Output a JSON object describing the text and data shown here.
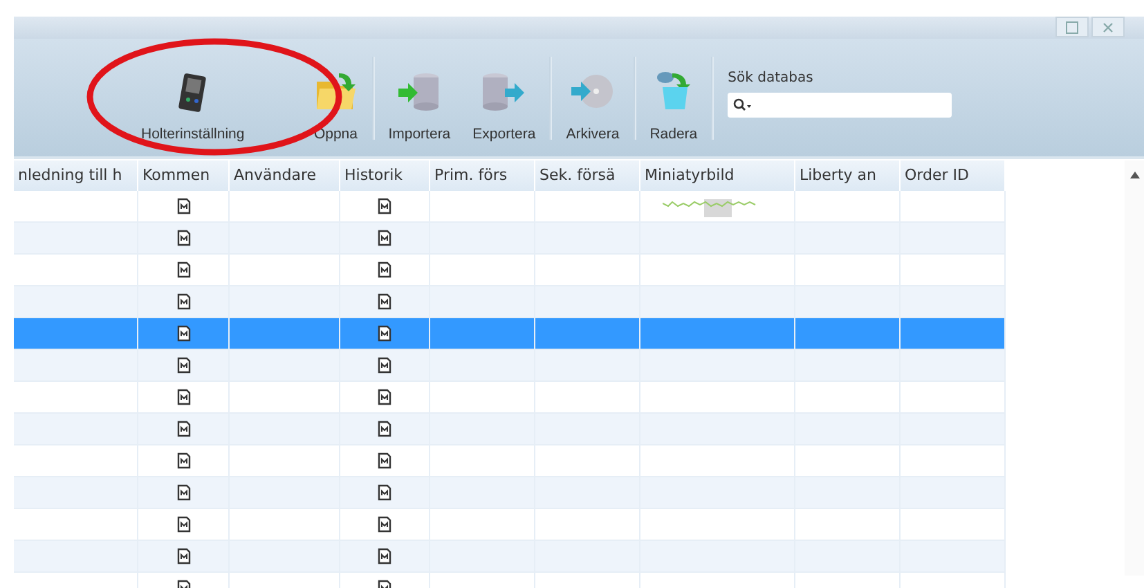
{
  "toolbar": {
    "buttons": [
      {
        "label": "Holterinställning",
        "kind": "device"
      },
      {
        "label": "Öppna",
        "kind": "folder"
      },
      {
        "label": "Importera",
        "kind": "import"
      },
      {
        "label": "Exportera",
        "kind": "export"
      },
      {
        "label": "Arkivera",
        "kind": "archive"
      },
      {
        "label": "Radera",
        "kind": "delete"
      }
    ],
    "search": {
      "label": "Sök databas"
    }
  },
  "table": {
    "columns": [
      "nledning till h",
      "Kommen",
      "Användare",
      "Historik",
      "Prim. förs",
      "Sek. försä",
      "Miniatyrbild",
      "Liberty an",
      "Order ID"
    ],
    "rows": [
      {
        "selected": false,
        "thumbnail": true
      },
      {
        "selected": false,
        "thumbnail": false
      },
      {
        "selected": false,
        "thumbnail": false
      },
      {
        "selected": false,
        "thumbnail": false
      },
      {
        "selected": true,
        "thumbnail": false
      },
      {
        "selected": false,
        "thumbnail": false
      },
      {
        "selected": false,
        "thumbnail": false
      },
      {
        "selected": false,
        "thumbnail": false
      },
      {
        "selected": false,
        "thumbnail": false
      },
      {
        "selected": false,
        "thumbnail": false
      },
      {
        "selected": false,
        "thumbnail": false
      },
      {
        "selected": false,
        "thumbnail": false
      },
      {
        "selected": false,
        "thumbnail": false
      }
    ]
  }
}
